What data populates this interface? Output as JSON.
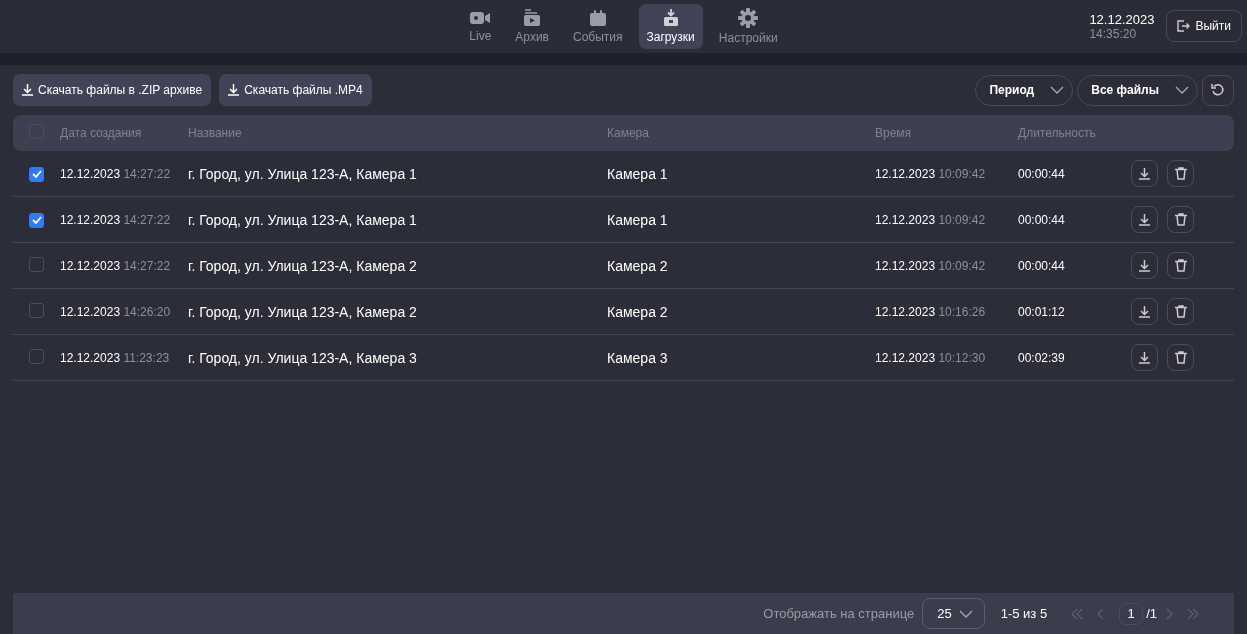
{
  "nav": [
    {
      "label": "Live",
      "selected": false
    },
    {
      "label": "Архив",
      "selected": false
    },
    {
      "label": "События",
      "selected": false
    },
    {
      "label": "Загрузки",
      "selected": true
    },
    {
      "label": "Настройки",
      "selected": false
    }
  ],
  "clock": {
    "date": "12.12.2023",
    "time": "14:35:20"
  },
  "logout_button": "Выйти",
  "toolbar": {
    "download_buttons": [
      "Скачать файлы в .ZIP архиве",
      "Скачать файлы .MP4"
    ],
    "filters": [
      "Период",
      "Все файлы"
    ]
  },
  "table": {
    "header_checked": false,
    "columns": [
      "Дата создания",
      "Название",
      "Камера",
      "Время",
      "Длительность"
    ],
    "rows": [
      {
        "checked": true,
        "created_date": "12.12.2023",
        "created_time": "14:27:22",
        "name": "г. Город, ул. Улица 123-А, Камера 1",
        "camera": "Камера 1",
        "time_date": "12.12.2023",
        "time_clock": "10:09:42",
        "duration": "00:00:44"
      },
      {
        "checked": true,
        "created_date": "12.12.2023",
        "created_time": "14:27:22",
        "name": "г. Город, ул. Улица 123-А, Камера 1",
        "camera": "Камера 1",
        "time_date": "12.12.2023",
        "time_clock": "10:09:42",
        "duration": "00:00:44"
      },
      {
        "checked": false,
        "created_date": "12.12.2023",
        "created_time": "14:27:22",
        "name": "г. Город, ул. Улица 123-А, Камера 2",
        "camera": "Камера 2",
        "time_date": "12.12.2023",
        "time_clock": "10:09:42",
        "duration": "00:00:44"
      },
      {
        "checked": false,
        "created_date": "12.12.2023",
        "created_time": "14:26:20",
        "name": "г. Город, ул. Улица 123-А, Камера 2",
        "camera": "Камера 2",
        "time_date": "12.12.2023",
        "time_clock": "10:16:26",
        "duration": "00:01:12"
      },
      {
        "checked": false,
        "created_date": "12.12.2023",
        "created_time": "11:23:23",
        "name": "г. Город, ул. Улица 123-А, Камера 3",
        "camera": "Камера 3",
        "time_date": "12.12.2023",
        "time_clock": "10:12:30",
        "duration": "00:02:39"
      }
    ]
  },
  "pagination": {
    "rows_per_page_label": "Отображать на странице",
    "rows_per_page": "25",
    "range": "1-5 из 5",
    "page": "1",
    "total_pages": "/1"
  }
}
